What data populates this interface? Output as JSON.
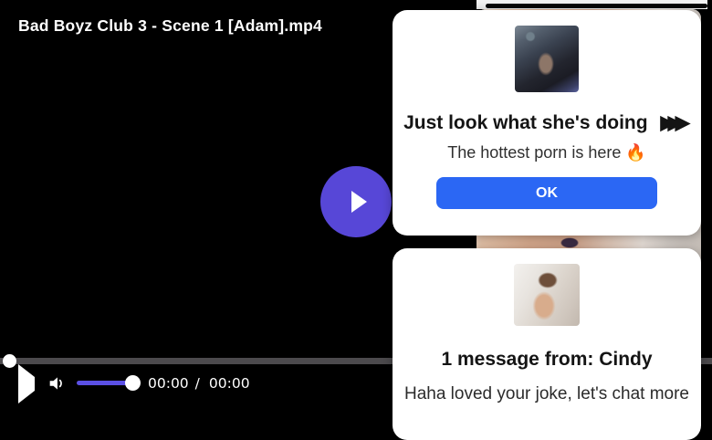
{
  "player": {
    "title": "Bad Boyz Club 3 - Scene 1 [Adam].mp4",
    "current_time": "00:00",
    "time_separator": "/",
    "duration": "00:00",
    "accent_color": "#5747d7",
    "volume_fill_color": "#5b50e4",
    "icons": {
      "big_play": "play-icon",
      "play": "play-icon",
      "volume": "speaker-icon"
    }
  },
  "popup_offer": {
    "thumbnail": "webcam-couple-photo",
    "heading": "Just look what she's doing",
    "heading_arrows": "▶▶▶",
    "subtext": "The hottest porn is here 🔥",
    "ok_label": "OK",
    "button_color": "#2b67f4"
  },
  "popup_message": {
    "thumbnail": "mirror-selfie-photo",
    "heading": "1 message from: Cindy",
    "text": "Haha loved your joke, let's chat more"
  },
  "sidebar": {
    "image": "hands-photo"
  }
}
